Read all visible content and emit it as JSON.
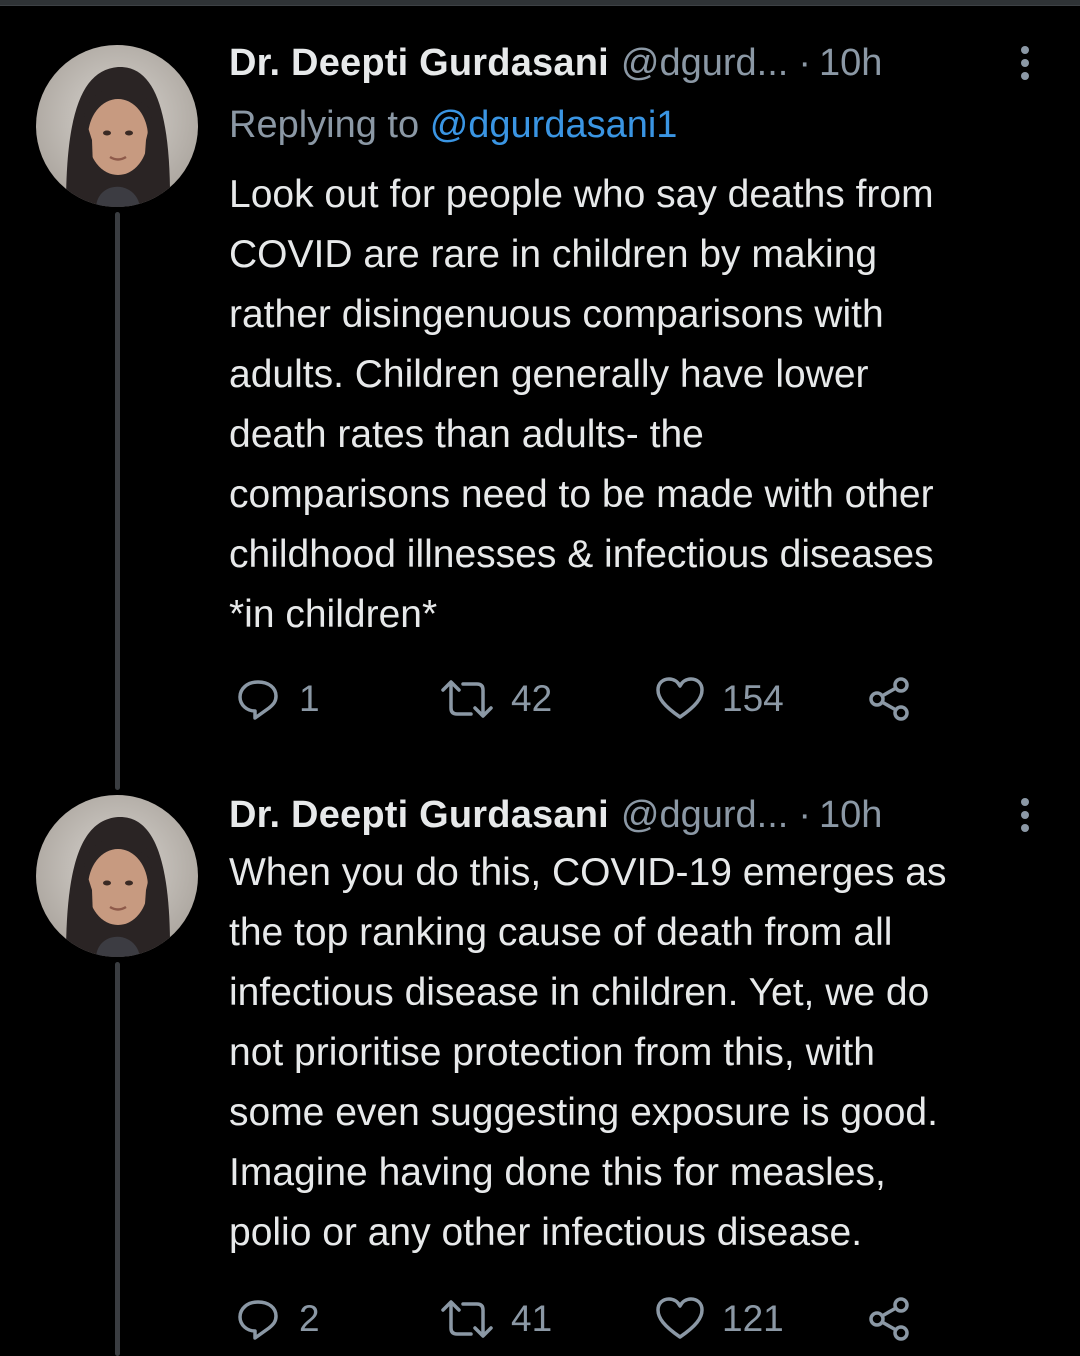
{
  "colors": {
    "background": "#000000",
    "text": "#e7e9ea",
    "secondary": "#8b98a5",
    "link": "#3a95e3",
    "thread_line": "#3a3d41"
  },
  "tweets": [
    {
      "display_name": "Dr. Deepti Gurdasani",
      "handle": "@dgurd...",
      "separator": "·",
      "timestamp": "10h",
      "reply_prefix": "Replying to",
      "reply_handle": "@dgurdasani1",
      "text_lines": [
        "Look out for people who say deaths from",
        "COVID are rare in children by making",
        "rather disingenuous comparisons with",
        "adults. Children generally have lower",
        "death rates than adults- the",
        "comparisons need to be made with other",
        "childhood illnesses & infectious diseases",
        "*in children*"
      ],
      "replies": "1",
      "retweets": "42",
      "likes": "154",
      "icons": {
        "avatar": "avatar-photo",
        "more": "more-options-icon",
        "reply": "reply-icon",
        "retweet": "retweet-icon",
        "like": "heart-icon",
        "share": "share-icon"
      }
    },
    {
      "display_name": "Dr. Deepti Gurdasani",
      "handle": "@dgurd...",
      "separator": "·",
      "timestamp": "10h",
      "text_lines": [
        "When you do this, COVID-19 emerges as",
        "the top ranking cause of death from all",
        "infectious disease in children. Yet, we do",
        "not prioritise protection from this, with",
        "some even suggesting exposure is good.",
        "Imagine having done this for measles,",
        "polio or any other infectious disease."
      ],
      "replies": "2",
      "retweets": "41",
      "likes": "121",
      "icons": {
        "avatar": "avatar-photo",
        "more": "more-options-icon",
        "reply": "reply-icon",
        "retweet": "retweet-icon",
        "like": "heart-icon",
        "share": "share-icon"
      }
    }
  ]
}
